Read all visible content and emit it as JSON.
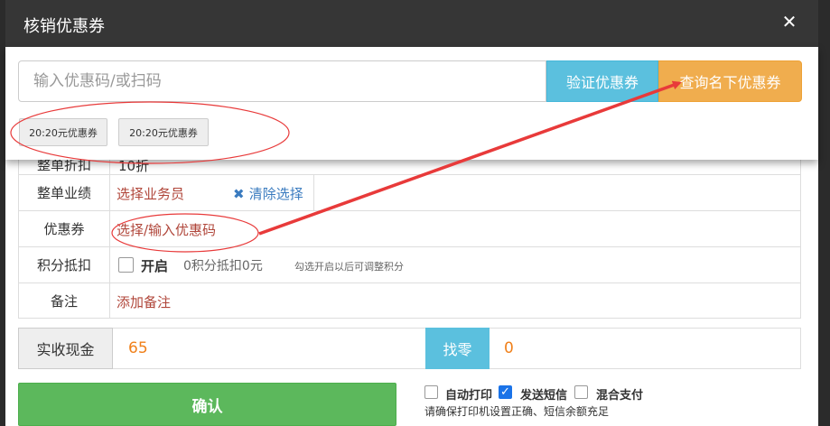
{
  "modal": {
    "title": "核销优惠券",
    "close_symbol": "✕",
    "input_placeholder": "输入优惠码/或扫码",
    "verify_label": "验证优惠券",
    "query_label": "查询名下优惠券",
    "coupons": [
      "20:20元优惠券",
      "20:20元优惠券"
    ]
  },
  "form": {
    "hidden_row_label": "整单折扣",
    "hidden_row_value": "10折",
    "performance": {
      "label": "整单业绩",
      "select_link": "选择业务员",
      "clear_link": "清除选择"
    },
    "coupon": {
      "label": "优惠券",
      "link": "选择/输入优惠码"
    },
    "points": {
      "label": "积分抵扣",
      "toggle_label": "开启",
      "value_text": "0积分抵扣0元",
      "hint": "勾选开启以后可调整积分"
    },
    "remark": {
      "label": "备注",
      "link": "添加备注"
    }
  },
  "payment": {
    "cash_label": "实收现金",
    "cash_value": "65",
    "change_label": "找零",
    "change_value": "0",
    "confirm_label": "确认",
    "options": [
      {
        "label": "自动打印",
        "checked": false
      },
      {
        "label": "发送短信",
        "checked": true
      },
      {
        "label": "混合支付",
        "checked": false
      }
    ],
    "note": "请确保打印机设置正确、短信余额充足"
  },
  "colors": {
    "accent_info": "#5bc0de",
    "accent_warning": "#f0ad4e",
    "accent_success": "#5cb85c",
    "annotation": "#e83a3a"
  }
}
